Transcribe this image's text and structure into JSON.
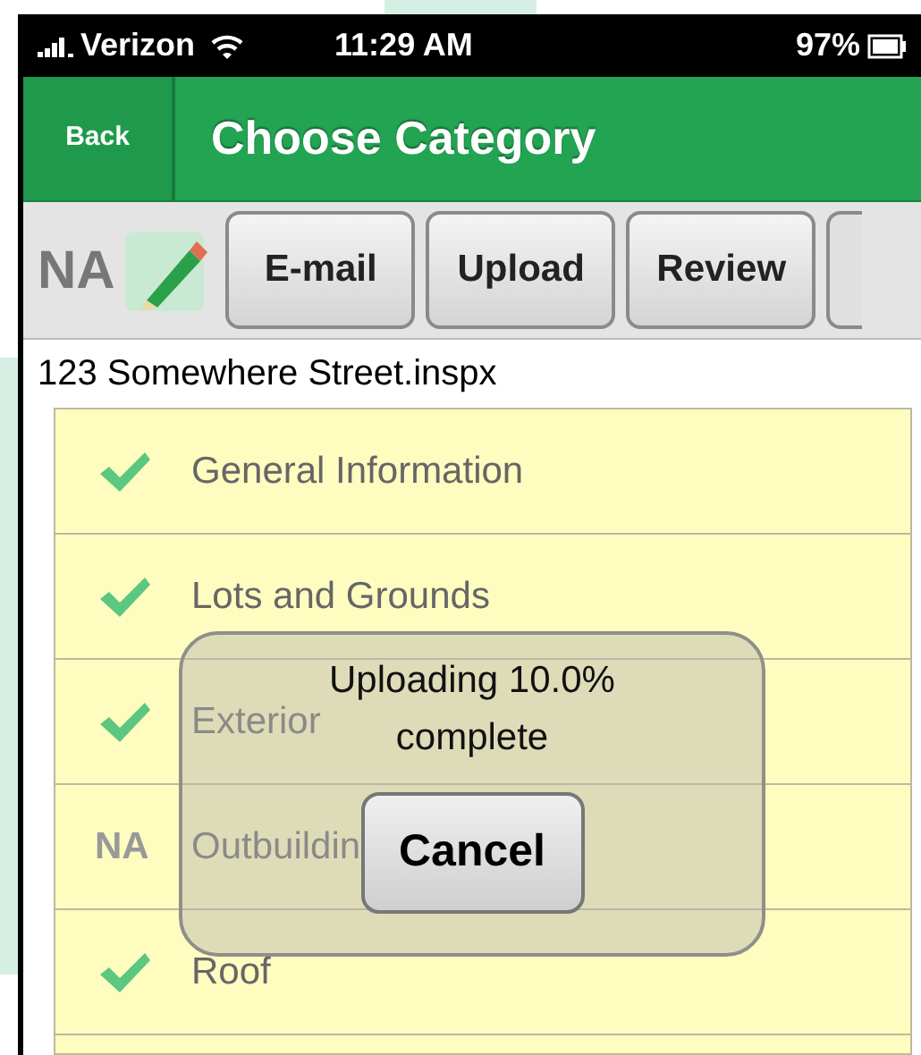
{
  "status_bar": {
    "carrier": "Verizon",
    "time": "11:29 AM",
    "battery": "97%"
  },
  "nav_bar": {
    "back": "Back",
    "title": "Choose Category"
  },
  "toolbar": {
    "status": "NA",
    "buttons": [
      "E-mail",
      "Upload",
      "Review"
    ]
  },
  "file_name": "123 Somewhere Street.inspx",
  "categories": [
    {
      "label": "General Information",
      "kind": "check"
    },
    {
      "label": "Lots and Grounds",
      "kind": "check"
    },
    {
      "label": "Exterior",
      "kind": "check"
    },
    {
      "label": "Outbuildin",
      "kind": "na",
      "mark": "NA"
    },
    {
      "label": "Roof",
      "kind": "check"
    }
  ],
  "dialog": {
    "message": "Uploading 10.0% complete",
    "button": "Cancel"
  }
}
